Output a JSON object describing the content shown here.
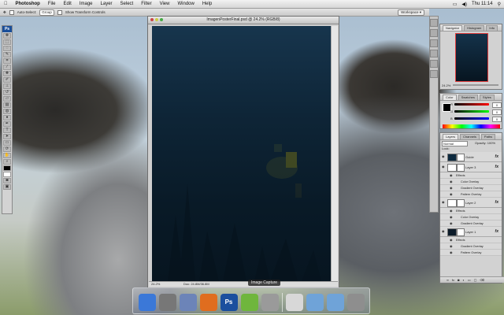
{
  "menubar": {
    "app_name": "Photoshop",
    "items": [
      "File",
      "Edit",
      "Image",
      "Layer",
      "Select",
      "Filter",
      "View",
      "Window",
      "Help"
    ],
    "clock": "Thu 11:14",
    "apple_icon": "apple-icon",
    "search_icon": "spotlight-icon"
  },
  "options_bar": {
    "auto_select_label": "Auto-Select:",
    "auto_select_value": "Group",
    "show_transform_label": "Show Transform Controls",
    "workspace_label": "Workspace ▾"
  },
  "tools": {
    "logo": "Ps"
  },
  "document": {
    "title": "ImagenPosterFinal.psd @ 24.2% (RGB/8)",
    "zoom": "24.2%",
    "doc_info": "Doc: 24.8M/36.8M",
    "capture_label": "Image Capture"
  },
  "navigator": {
    "tabs": [
      "Navigator",
      "Histogram",
      "Info"
    ],
    "zoom": "24.2%"
  },
  "color": {
    "tabs": [
      "Color",
      "Swatches",
      "Styles"
    ],
    "channels": [
      {
        "label": "R",
        "value": "0",
        "color": "#d23a3a"
      },
      {
        "label": "G",
        "value": "0",
        "color": "#3aa13a"
      },
      {
        "label": "B",
        "value": "0",
        "color": "#3a5ad2"
      }
    ]
  },
  "layers": {
    "tabs": [
      "Layers",
      "Channels",
      "Paths"
    ],
    "mode": "Normal",
    "opacity": "Opacity: 100%",
    "lock": "Lock:",
    "items": [
      {
        "name": "Guide",
        "type": "layer",
        "fx": "fx",
        "thumb": "#0d2a3f"
      },
      {
        "name": "Layer 3",
        "type": "layer",
        "fx": "fx",
        "thumb": "#ffffff"
      },
      {
        "name": "Effects",
        "type": "effects-header"
      },
      {
        "name": "Color Overlay",
        "type": "effect"
      },
      {
        "name": "Gradient Overlay",
        "type": "effect"
      },
      {
        "name": "Pattern Overlay",
        "type": "effect"
      },
      {
        "name": "Layer 2",
        "type": "layer",
        "fx": "fx",
        "thumb": "#ffffff"
      },
      {
        "name": "Effects",
        "type": "effects-header"
      },
      {
        "name": "Color Overlay",
        "type": "effect"
      },
      {
        "name": "Gradient Overlay",
        "type": "effect"
      },
      {
        "name": "Layer 1",
        "type": "layer",
        "fx": "fx",
        "thumb": "#0b1b29"
      },
      {
        "name": "Effects",
        "type": "effects-header"
      },
      {
        "name": "Gradient Overlay",
        "type": "effect"
      },
      {
        "name": "Pattern Overlay",
        "type": "effect"
      }
    ]
  },
  "dock": {
    "items": [
      {
        "name": "finder-icon",
        "label": "",
        "color": "#3b78d8"
      },
      {
        "name": "system-preferences-icon",
        "label": "",
        "color": "#777777"
      },
      {
        "name": "preview-icon",
        "label": "",
        "color": "#6c84b8"
      },
      {
        "name": "firefox-icon",
        "label": "",
        "color": "#e06d1f"
      },
      {
        "name": "photoshop-icon",
        "label": "Ps",
        "color": "#1b4f9e"
      },
      {
        "name": "spotify-icon",
        "label": "",
        "color": "#6fb63d"
      },
      {
        "name": "image-capture-icon",
        "label": "",
        "color": "#9a9a9a"
      },
      {
        "name": "document-icon",
        "label": "",
        "color": "#d8d8d8"
      },
      {
        "name": "folder-icon",
        "label": "",
        "color": "#6fa3d8"
      },
      {
        "name": "downloads-folder-icon",
        "label": "",
        "color": "#6fa3d8"
      },
      {
        "name": "trash-icon",
        "label": "",
        "color": "#8e8e8e"
      }
    ]
  }
}
